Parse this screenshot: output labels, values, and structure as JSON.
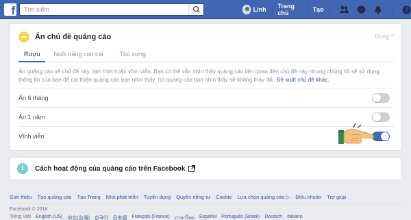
{
  "topbar": {
    "search_placeholder": "Tìm kiếm",
    "user_name": "Linh",
    "home_label": "Trang chủ",
    "create_label": "Tạo",
    "icons": [
      "friends-icon",
      "messenger-icon",
      "notifications-icon",
      "help-icon",
      "menu-caret-icon"
    ]
  },
  "card": {
    "title": "Ẩn chủ đề quảng cáo",
    "close_label": "Đóng ^",
    "tabs": [
      {
        "label": "Rượu",
        "active": true
      },
      {
        "label": "Nuôi nấng con cái",
        "active": false
      },
      {
        "label": "Thú cưng",
        "active": false
      }
    ],
    "description": "Ẩn quảng cáo về chủ đề này, tạm thời hoặc vĩnh viễn. Bạn có thể vẫn nhìn thấy quảng cáo liên quan đến chủ đề này nhưng chúng tôi sẽ sử dụng thông tin của bạn để cải thiện quảng cáo bạn nhìn thấy. Số quảng cáo bạn nhìn thấy sẽ không thay đổi.",
    "suggest_link": "Đề xuất chủ đề khác.",
    "options": [
      {
        "label": "Ẩn 6 tháng",
        "enabled": false
      },
      {
        "label": "Ẩn 1 năm",
        "enabled": false
      },
      {
        "label": "Vĩnh viễn",
        "enabled": true
      }
    ]
  },
  "card2": {
    "title": "Cách hoạt động của quảng cáo trên Facebook"
  },
  "footer": {
    "links": [
      "Giới thiệu",
      "Tạo quảng cáo",
      "Tạo Trang",
      "Nhà phát triển",
      "Tuyển dụng",
      "Quyền riêng tư",
      "Cookie",
      "Lựa chọn quảng cáo ▷",
      "Điều khoản",
      "Trợ giúp"
    ],
    "copyright": "Facebook © 2018",
    "languages": [
      "Tiếng Việt",
      "English (US)",
      "中文(台灣)",
      "한국어",
      "日本語",
      "Français (France)",
      "ภาษาไทย",
      "Español",
      "Português (Brasil)",
      "Deutsch",
      "Italiano"
    ]
  },
  "colors": {
    "brand": "#4267b2",
    "toggle_on": "#4267b2",
    "toggle_off": "#ccd0d5",
    "topic_dot": "#f7d34b",
    "info_dot": "#7bd0c6"
  }
}
